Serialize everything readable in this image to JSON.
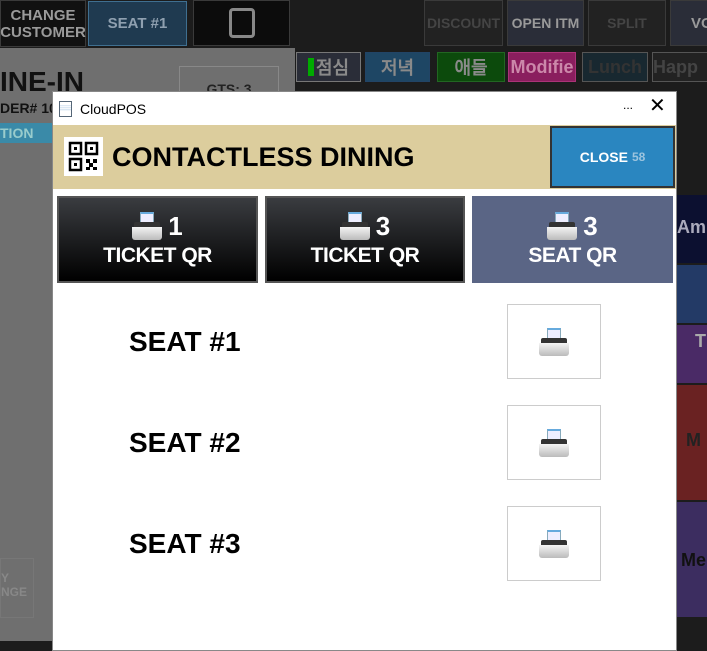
{
  "background": {
    "top_buttons": [
      "CHANGE\nCUSTOMER",
      "SEAT #1",
      "DISCOUNT",
      "OPEN ITM",
      "SPLIT",
      "VO"
    ],
    "order_type": "INE-IN",
    "order_no": "DER# 10",
    "section": "TION",
    "guests": "GTS: 3",
    "categories": [
      "점심",
      "저녁",
      "애들",
      "Modifie",
      "Lunch",
      "Happ"
    ],
    "side_labels": [
      "Am",
      "T",
      "M",
      "Me"
    ],
    "bottom_left": "Y\nNGE"
  },
  "dialog": {
    "window_title": "CloudPOS",
    "minimize_label": "...",
    "header_title": "CONTACTLESS DINING",
    "close_label": "CLOSE",
    "close_countdown": "58",
    "qr_buttons": [
      {
        "count": "1",
        "label": "TICKET QR"
      },
      {
        "count": "3",
        "label": "TICKET QR"
      },
      {
        "count": "3",
        "label": "SEAT QR",
        "selected": true
      }
    ],
    "seats": [
      {
        "label": "SEAT #1"
      },
      {
        "label": "SEAT #2"
      },
      {
        "label": "SEAT #3"
      }
    ],
    "colors": {
      "header": "#dccd9d",
      "close": "#2a86c0",
      "selected": "#5a6585"
    }
  }
}
